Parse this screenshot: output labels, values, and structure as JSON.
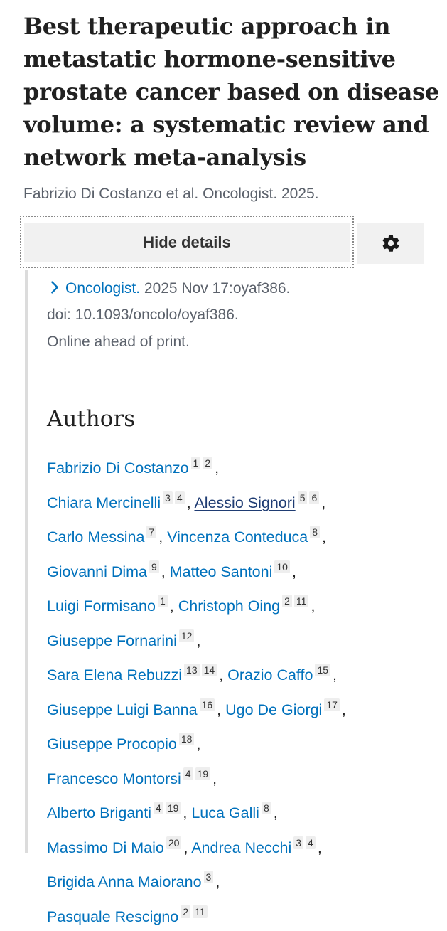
{
  "article": {
    "title": "Best therapeutic approach in metastatic hormone-sensitive prostate cancer based on disease volume: a systematic review and network meta-analysis",
    "citation": "Fabrizio Di Costanzo et al. Oncologist. 2025."
  },
  "details": {
    "hide_label": "Hide details",
    "settings_icon": "gear-icon"
  },
  "publication": {
    "journal": "Oncologist.",
    "date_pages": " 2025 Nov 17:oyaf386.",
    "doi": "doi: 10.1093/oncolo/oyaf386.",
    "status": "Online ahead of print."
  },
  "authors": {
    "heading": "Authors",
    "lines": [
      [
        {
          "name": "Fabrizio Di Costanzo",
          "affs": [
            "1",
            "2"
          ]
        }
      ],
      [
        {
          "name": "Chiara Mercinelli",
          "affs": [
            "3",
            "4"
          ]
        },
        {
          "name": "Alessio Signori",
          "affs": [
            "5",
            "6"
          ],
          "visited": true
        }
      ],
      [
        {
          "name": "Carlo Messina",
          "affs": [
            "7"
          ]
        },
        {
          "name": "Vincenza Conteduca",
          "affs": [
            "8"
          ]
        }
      ],
      [
        {
          "name": "Giovanni Dima",
          "affs": [
            "9"
          ]
        },
        {
          "name": "Matteo Santoni",
          "affs": [
            "10"
          ]
        }
      ],
      [
        {
          "name": "Luigi Formisano",
          "affs": [
            "1"
          ]
        },
        {
          "name": "Christoph Oing",
          "affs": [
            "2",
            "11"
          ]
        }
      ],
      [
        {
          "name": "Giuseppe Fornarini",
          "affs": [
            "12"
          ]
        }
      ],
      [
        {
          "name": "Sara Elena Rebuzzi",
          "affs": [
            "13",
            "14"
          ]
        },
        {
          "name": "Orazio Caffo",
          "affs": [
            "15"
          ]
        }
      ],
      [
        {
          "name": "Giuseppe Luigi Banna",
          "affs": [
            "16"
          ]
        },
        {
          "name": "Ugo De Giorgi",
          "affs": [
            "17"
          ]
        }
      ],
      [
        {
          "name": "Giuseppe Procopio",
          "affs": [
            "18"
          ]
        }
      ],
      [
        {
          "name": "Francesco Montorsi",
          "affs": [
            "4",
            "19"
          ]
        }
      ],
      [
        {
          "name": "Alberto Briganti",
          "affs": [
            "4",
            "19"
          ]
        },
        {
          "name": "Luca Galli",
          "affs": [
            "8"
          ]
        }
      ],
      [
        {
          "name": "Massimo Di Maio",
          "affs": [
            "20"
          ]
        },
        {
          "name": "Andrea Necchi",
          "affs": [
            "3",
            "4"
          ]
        }
      ],
      [
        {
          "name": "Brigida Anna Maiorano",
          "affs": [
            "3"
          ]
        }
      ],
      [
        {
          "name": "Pasquale Rescigno",
          "affs": [
            "2",
            "11"
          ],
          "last": true
        }
      ]
    ]
  },
  "colors": {
    "link": "#0071bc",
    "visited_link": "#1f3c73",
    "muted_text": "#5b616b",
    "button_bg": "#f1f1f1"
  }
}
